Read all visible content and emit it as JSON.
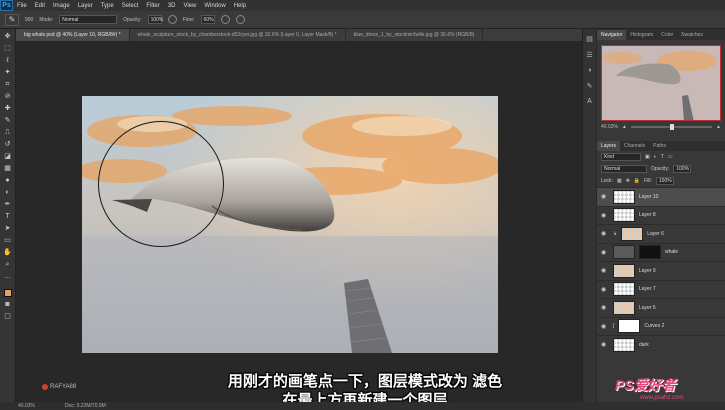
{
  "app": {
    "logo": "Ps"
  },
  "menu": [
    "File",
    "Edit",
    "Image",
    "Layer",
    "Type",
    "Select",
    "Filter",
    "3D",
    "View",
    "Window",
    "Help"
  ],
  "options": {
    "brush_size": "900",
    "mode_label": "Mode:",
    "mode_value": "Normal",
    "opacity_label": "Opacity:",
    "opacity_value": "100%",
    "flow_label": "Flow:",
    "flow_value": "60%"
  },
  "tabs": [
    "big whale.psd @ 40% (Layer 10, RGB/8#) *",
    "whale_sculpture_stock_by_chamberstock-d53zyei.jpg @ 32.6% (Layer 0, Layer Mask/8) *",
    "blue_dress_1_by_stockmichelle.jpg @ 36.6% (RGB/8)"
  ],
  "status": {
    "zoom": "40.03%",
    "doc": "Doc: 9.22M/70.9M"
  },
  "watermark": "RAFYA88",
  "subtitles": {
    "line1": "用刚才的画笔点一下，图层模式改为 滤色",
    "line2": "在最上方再新建一个图层"
  },
  "panel": {
    "top_tabs": [
      "Navigator",
      "Histogram",
      "Color",
      "Swatches"
    ],
    "nav_zoom": "40.03%",
    "layer_tabs": [
      "Layers",
      "Channels",
      "Paths"
    ],
    "kind": "Kind",
    "blend": "Normal",
    "opacity_label": "Opacity:",
    "opacity": "100%",
    "lock_label": "Lock:",
    "fill_label": "Fill:",
    "fill": "100%",
    "layers": [
      {
        "name": "Layer 10",
        "thumb": "transparent",
        "active": true
      },
      {
        "name": "Layer 8",
        "thumb": "transparent",
        "active": false
      },
      {
        "name": "Layer 6",
        "thumb": "orange",
        "active": false
      },
      {
        "name": "whale",
        "thumb": "dark",
        "active": false
      },
      {
        "name": "Layer 9",
        "thumb": "orange",
        "active": false
      },
      {
        "name": "Layer 7",
        "thumb": "transparent",
        "active": false
      },
      {
        "name": "Layer 5",
        "thumb": "orange",
        "active": false
      },
      {
        "name": "Curves 2",
        "thumb": "white",
        "active": false
      },
      {
        "name": "dark",
        "thumb": "transparent",
        "active": false
      }
    ]
  },
  "site_logo": {
    "text": "PS爱好者",
    "url": "www.psahz.com"
  },
  "colors": {
    "foreground": "#e3a463",
    "accent": "#b83030"
  }
}
